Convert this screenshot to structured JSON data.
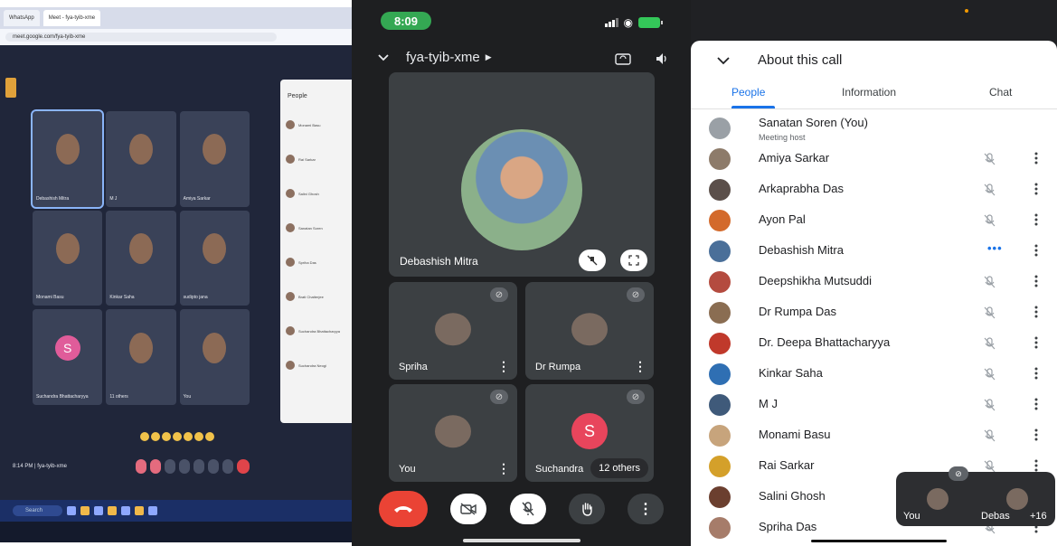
{
  "laptop": {
    "tabs": [
      "WhatsApp",
      "Meet - fya-tyib-xme"
    ],
    "url": "meet.google.com/fya-tyib-xme",
    "tiles": [
      {
        "name": "Debashish Mitra",
        "active": true
      },
      {
        "name": "M J"
      },
      {
        "name": "Amiya Sarkar"
      },
      {
        "name": "Monami Basu"
      },
      {
        "name": "Kinkar Saha"
      },
      {
        "name": "sudipto jana"
      },
      {
        "name": "Suchandra Bhattacharyya",
        "letter": "S"
      },
      {
        "name": "11 others"
      },
      {
        "name": "You"
      }
    ],
    "people_title": "People",
    "people": [
      "Monami Basu",
      "Rai Sarkar",
      "Salini Ghosh",
      "Sanatan Soren",
      "Spriha Das",
      "Brati Chatterjee",
      "Suchandra Bhattacharyya",
      "Suchandra Neogi"
    ],
    "footer": "8:14 PM | fya-tyib-xme",
    "search_placeholder": "Search"
  },
  "phone": {
    "time": "8:09",
    "meeting_code": "fya-tyib-xme",
    "main_speaker": "Debashish Mitra",
    "tiles": [
      {
        "name": "Spriha"
      },
      {
        "name": "Dr Rumpa"
      },
      {
        "name": "You"
      },
      {
        "name": "Suchandra",
        "letter": "S",
        "others": "12 others"
      }
    ]
  },
  "about": {
    "title": "About this call",
    "tabs": [
      "People",
      "Information",
      "Chat"
    ],
    "active_tab": "People",
    "participants": [
      {
        "name": "Sanatan Soren (You)",
        "subtitle": "Meeting host",
        "color": "#9aa0a6"
      },
      {
        "name": "Amiya Sarkar",
        "color": "#8d7b6a"
      },
      {
        "name": "Arkaprabha Das",
        "color": "#5b4f4a"
      },
      {
        "name": "Ayon Pal",
        "color": "#d36a2c"
      },
      {
        "name": "Debashish Mitra",
        "color": "#4a6f99",
        "speaking": true
      },
      {
        "name": "Deepshikha Mutsuddi",
        "color": "#b44b3f"
      },
      {
        "name": "Dr Rumpa Das",
        "color": "#8a6d52"
      },
      {
        "name": "Dr. Deepa Bhattacharyya",
        "color": "#c0392b"
      },
      {
        "name": "Kinkar Saha",
        "color": "#2f6fb3"
      },
      {
        "name": "M J",
        "color": "#3f5a7a"
      },
      {
        "name": "Monami Basu",
        "color": "#c7a47c"
      },
      {
        "name": "Rai Sarkar",
        "color": "#d4a02a"
      },
      {
        "name": "Salini Ghosh",
        "color": "#6b3f2f"
      },
      {
        "name": "Spriha Das",
        "color": "#a67c6a"
      }
    ],
    "pip": {
      "left_name": "You",
      "right_name": "Debas",
      "right_count": "+16"
    }
  }
}
